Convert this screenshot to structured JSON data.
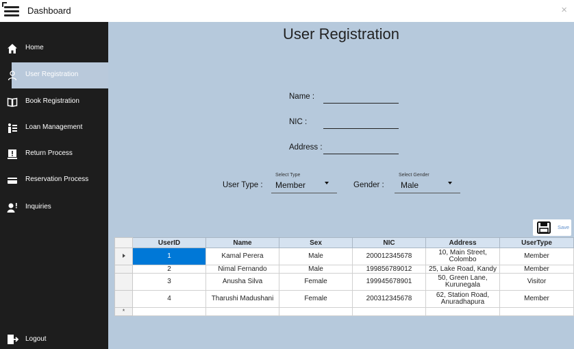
{
  "window": {
    "title": "Dashboard",
    "close": "×"
  },
  "sidebar": {
    "items": [
      {
        "label": "Home",
        "icon": "home-icon"
      },
      {
        "label": "User Registration",
        "icon": "user-icon",
        "active": true
      },
      {
        "label": "Book Registration",
        "icon": "book-icon"
      },
      {
        "label": "Loan Management",
        "icon": "loan-icon"
      },
      {
        "label": "Return Process",
        "icon": "return-icon"
      },
      {
        "label": "Reservation Process",
        "icon": "reservation-icon"
      },
      {
        "label": "Inquiries",
        "icon": "inquiries-icon"
      }
    ],
    "logout": {
      "label": "Logout",
      "icon": "logout-icon"
    }
  },
  "main": {
    "title": "User Registration",
    "form": {
      "name_label": "Name :",
      "nic_label": "NIC :",
      "address_label": "Address :",
      "usertype_label": "User Type :",
      "usertype_hint": "Select Type",
      "usertype_value": "Member",
      "gender_label": "Gender :",
      "gender_hint": "Select Gender",
      "gender_value": "Male"
    },
    "save_label": "Save",
    "table": {
      "columns": [
        "UserID",
        "Name",
        "Sex",
        "NIC",
        "Address",
        "UserType"
      ],
      "rows": [
        [
          "1",
          "Kamal Perera",
          "Male",
          "200012345678",
          "10, Main Street, Colombo",
          "Member"
        ],
        [
          "2",
          "Nimal Fernando",
          "Male",
          "199856789012",
          "25, Lake Road, Kandy",
          "Member"
        ],
        [
          "3",
          "Anusha Silva",
          "Female",
          "199945678901",
          "50, Green Lane, Kurunegala",
          "Visitor"
        ],
        [
          "4",
          "Tharushi Madushani",
          "Female",
          "200312345678",
          "62, Station Road, Anuradhapura",
          "Member"
        ]
      ],
      "new_row_marker": "*"
    }
  },
  "colors": {
    "sidebar": "#1d1d1d",
    "main": "#b6c9dc",
    "active_item": "#b9c9db",
    "selection": "#0078d7",
    "save_text": "#5f8fcb"
  }
}
